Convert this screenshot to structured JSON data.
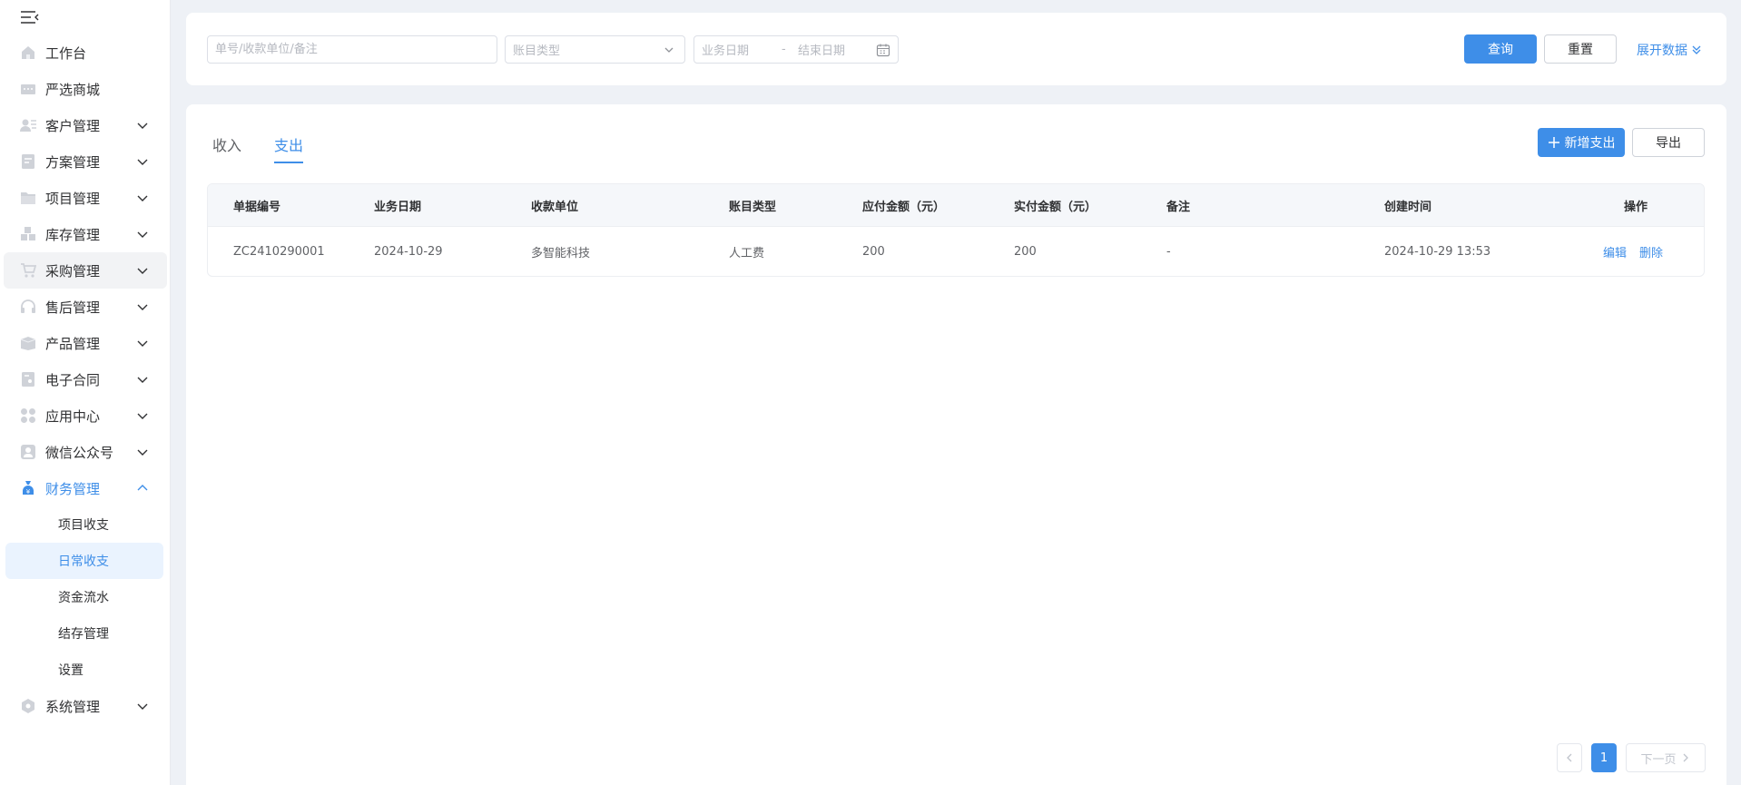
{
  "sidebar": {
    "items": [
      {
        "label": "工作台",
        "icon": "home-icon",
        "has_arrow": false
      },
      {
        "label": "严选商城",
        "icon": "store-icon",
        "has_arrow": false
      },
      {
        "label": "客户管理",
        "icon": "customer-icon",
        "has_arrow": true
      },
      {
        "label": "方案管理",
        "icon": "plan-icon",
        "has_arrow": true
      },
      {
        "label": "项目管理",
        "icon": "folder-icon",
        "has_arrow": true
      },
      {
        "label": "库存管理",
        "icon": "inventory-icon",
        "has_arrow": true
      },
      {
        "label": "采购管理",
        "icon": "cart-icon",
        "has_arrow": true
      },
      {
        "label": "售后管理",
        "icon": "headset-icon",
        "has_arrow": true
      },
      {
        "label": "产品管理",
        "icon": "box-icon",
        "has_arrow": true
      },
      {
        "label": "电子合同",
        "icon": "contract-icon",
        "has_arrow": true
      },
      {
        "label": "应用中心",
        "icon": "apps-icon",
        "has_arrow": true
      },
      {
        "label": "微信公众号",
        "icon": "wechat-icon",
        "has_arrow": true
      },
      {
        "label": "财务管理",
        "icon": "money-bag-icon",
        "has_arrow": true
      }
    ],
    "finance_sub": [
      "项目收支",
      "日常收支",
      "资金流水",
      "结存管理",
      "设置"
    ],
    "system": {
      "label": "系统管理",
      "icon": "settings-icon"
    }
  },
  "filter": {
    "search_placeholder": "单号/收款单位/备注",
    "type_placeholder": "账目类型",
    "start_placeholder": "业务日期",
    "range_sep": "-",
    "end_placeholder": "结束日期",
    "query_label": "查询",
    "reset_label": "重置",
    "expand_label": "展开数据"
  },
  "tabs": {
    "income": "收入",
    "expense": "支出"
  },
  "actions": {
    "add_label": "新增支出",
    "export_label": "导出"
  },
  "table": {
    "headers": [
      "单据编号",
      "业务日期",
      "收款单位",
      "账目类型",
      "应付金额（元）",
      "实付金额（元）",
      "备注",
      "创建时间",
      "操作"
    ],
    "rows": [
      {
        "id": "ZC2410290001",
        "date": "2024-10-29",
        "payee": "多智能科技",
        "type": "人工费",
        "payable": "200",
        "paid": "200",
        "note": "-",
        "created": "2024-10-29 13:53",
        "edit": "编辑",
        "delete": "删除"
      }
    ]
  },
  "pagination": {
    "current": "1",
    "next_label": "下一页"
  },
  "colors": {
    "primary": "#3e8ee8",
    "active_bg": "#eaf3fe",
    "page_bg": "#eef1f6"
  }
}
